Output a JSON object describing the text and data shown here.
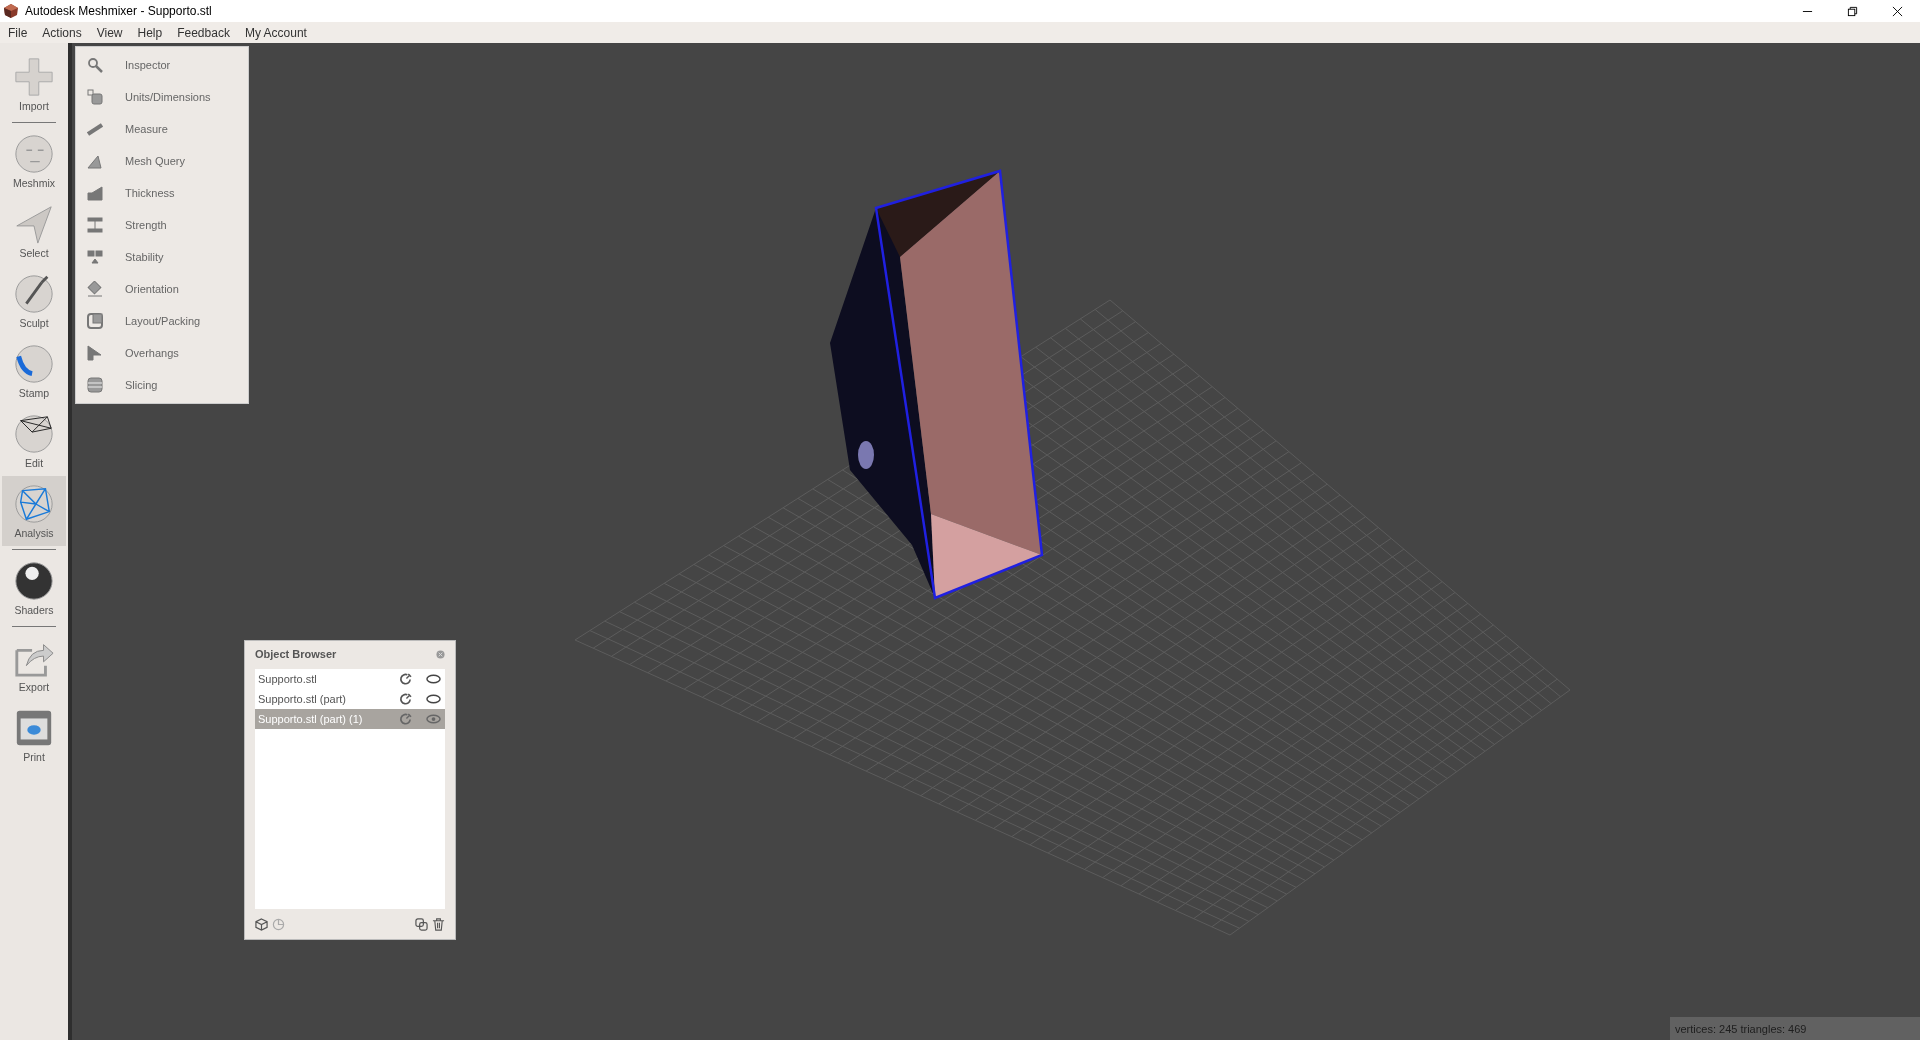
{
  "window": {
    "title": "Autodesk Meshmixer - Supporto.stl"
  },
  "menu_bar": [
    "File",
    "Actions",
    "View",
    "Help",
    "Feedback",
    "My Account"
  ],
  "toolbar": {
    "groups": [
      [
        {
          "label": "Import",
          "selected": false
        }
      ],
      [
        {
          "label": "Meshmix",
          "selected": false
        },
        {
          "label": "Select",
          "selected": false
        },
        {
          "label": "Sculpt",
          "selected": false
        },
        {
          "label": "Stamp",
          "selected": false
        },
        {
          "label": "Edit",
          "selected": false
        },
        {
          "label": "Analysis",
          "selected": true
        }
      ],
      [
        {
          "label": "Shaders",
          "selected": false
        }
      ],
      [
        {
          "label": "Export",
          "selected": false
        },
        {
          "label": "Print",
          "selected": false
        }
      ]
    ]
  },
  "analysis_menu": [
    "Inspector",
    "Units/Dimensions",
    "Measure",
    "Mesh Query",
    "Thickness",
    "Strength",
    "Stability",
    "Orientation",
    "Layout/Packing",
    "Overhangs",
    "Slicing"
  ],
  "object_browser": {
    "title": "Object Browser",
    "rows": [
      {
        "name": "Supporto.stl",
        "selected": false
      },
      {
        "name": "Supporto.stl (part)",
        "selected": false
      },
      {
        "name": "Supporto.stl (part) (1)",
        "selected": true
      }
    ]
  },
  "status_bar": "vertices: 245 triangles: 469"
}
